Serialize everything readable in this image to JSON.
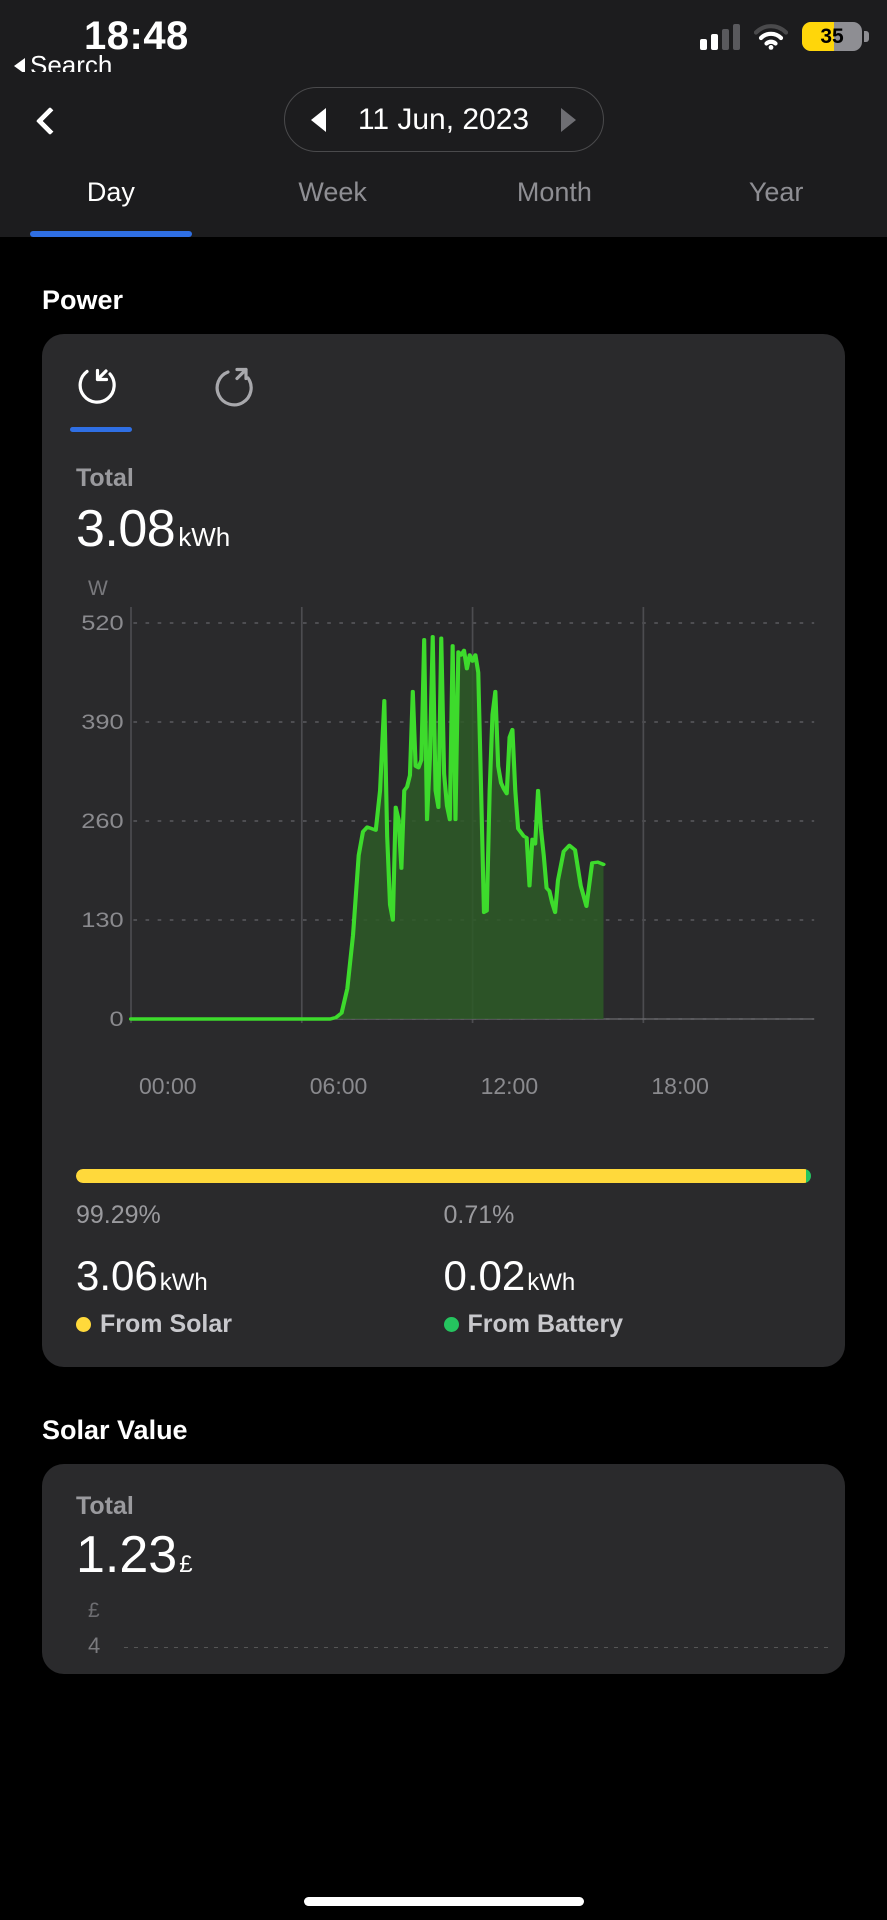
{
  "statusbar": {
    "time": "18:48",
    "back_label": "Search",
    "battery_percent": "35",
    "signal_bars_total": 4,
    "signal_bars_active": 2,
    "icons": [
      "cellular-signal-icon",
      "wifi-icon",
      "battery-icon"
    ]
  },
  "nav": {
    "back_icon": "chevron-left-icon",
    "date": "11 Jun, 2023",
    "prev_icon": "triangle-left-icon",
    "next_icon": "triangle-right-icon"
  },
  "tabs": [
    {
      "label": "Day",
      "active": true
    },
    {
      "label": "Week",
      "active": false
    },
    {
      "label": "Month",
      "active": false
    },
    {
      "label": "Year",
      "active": false
    }
  ],
  "power_section": {
    "title": "Power",
    "flow_tabs": [
      {
        "icon": "rotate-arrow-in-icon",
        "active": true
      },
      {
        "icon": "rotate-arrow-out-icon",
        "active": false
      }
    ],
    "total_label": "Total",
    "total_value": "3.08",
    "total_unit": "kWh",
    "split": {
      "left_pct_label": "99.29%",
      "right_pct_label": "0.71%",
      "left_pct": 99.29,
      "right_pct": 0.71,
      "left_value": "3.06",
      "left_unit": "kWh",
      "left_legend": "From Solar",
      "left_color": "#ffd93b",
      "right_value": "0.02",
      "right_unit": "kWh",
      "right_legend": "From Battery",
      "right_color": "#25c45f"
    }
  },
  "solar_value_section": {
    "title": "Solar Value",
    "total_label": "Total",
    "total_value": "1.23",
    "total_unit": "£",
    "axis_unit": "£",
    "axis_tick": "4"
  },
  "chart_data": {
    "type": "area",
    "title": "Power",
    "xlabel": "",
    "ylabel": "W",
    "ylim": [
      0,
      520
    ],
    "yticks": [
      0,
      130,
      260,
      390,
      520
    ],
    "ytick_labels": [
      "0",
      "130",
      "260",
      "390",
      "520"
    ],
    "xlim": [
      0,
      24
    ],
    "xticks": [
      0,
      6,
      12,
      18
    ],
    "xtick_labels": [
      "00:00",
      "06:00",
      "12:00",
      "18:00"
    ],
    "grid": true,
    "legend": "none",
    "line_color": "#3ddb2c",
    "fill_color": "#2d5a27",
    "series": [
      {
        "name": "Power",
        "unit": "W",
        "x": [
          0.0,
          0.5,
          1.0,
          1.5,
          2.0,
          2.5,
          3.0,
          3.5,
          4.0,
          4.5,
          5.0,
          5.5,
          6.0,
          6.5,
          7.0,
          7.2,
          7.4,
          7.6,
          7.8,
          8.0,
          8.15,
          8.3,
          8.45,
          8.6,
          8.75,
          8.9,
          9.0,
          9.1,
          9.2,
          9.3,
          9.4,
          9.5,
          9.6,
          9.7,
          9.8,
          9.9,
          10.0,
          10.1,
          10.2,
          10.3,
          10.4,
          10.5,
          10.6,
          10.7,
          10.8,
          10.9,
          11.0,
          11.1,
          11.2,
          11.3,
          11.4,
          11.5,
          11.6,
          11.7,
          11.8,
          11.9,
          12.0,
          12.1,
          12.2,
          12.3,
          12.4,
          12.5,
          12.6,
          12.7,
          12.8,
          12.9,
          13.0,
          13.1,
          13.2,
          13.3,
          13.4,
          13.5,
          13.6,
          13.7,
          13.8,
          13.9,
          14.0,
          14.1,
          14.2,
          14.3,
          14.4,
          14.5,
          14.6,
          14.7,
          14.8,
          14.9,
          15.0,
          15.2,
          15.4,
          15.6,
          15.8,
          16.0,
          16.2,
          16.4,
          16.6
        ],
        "y": [
          0,
          0,
          0,
          0,
          0,
          0,
          0,
          0,
          0,
          0,
          0,
          0,
          0,
          0,
          0,
          2,
          8,
          40,
          110,
          215,
          246,
          252,
          250,
          248,
          300,
          418,
          240,
          150,
          130,
          278,
          262,
          198,
          300,
          305,
          320,
          430,
          332,
          330,
          340,
          498,
          262,
          342,
          502,
          300,
          278,
          500,
          322,
          280,
          262,
          490,
          262,
          482,
          478,
          484,
          460,
          478,
          470,
          478,
          455,
          300,
          140,
          142,
          300,
          400,
          430,
          332,
          310,
          302,
          296,
          370,
          380,
          300,
          250,
          245,
          240,
          238,
          175,
          236,
          230,
          300,
          250,
          215,
          172,
          168,
          152,
          140,
          182,
          220,
          228,
          222,
          175,
          148,
          205,
          206,
          203
        ]
      }
    ]
  }
}
